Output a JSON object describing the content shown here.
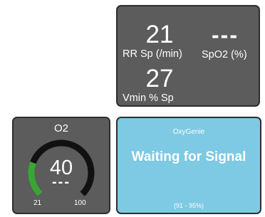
{
  "monitor": {
    "rr_value": "21",
    "rr_label": "RR Sp (/min)",
    "spo2_value": "---",
    "spo2_label": "SpO2 (%)",
    "vmin_value": "27",
    "vmin_label": "Vmin % Sp"
  },
  "o2_gauge": {
    "title": "O2",
    "value": "40",
    "secondary": "---",
    "min_label": "21",
    "max_label": "100",
    "min": 21,
    "max": 100,
    "fill_value": 40,
    "colors": {
      "fill": "#3aa535",
      "track": "#111111",
      "panel": "#5c5c5c"
    }
  },
  "oxygenie": {
    "title": "OxyGenie",
    "status": "Waiting for Signal",
    "range": "(91 - 95%)",
    "colors": {
      "background": "#7ec9e3"
    }
  }
}
